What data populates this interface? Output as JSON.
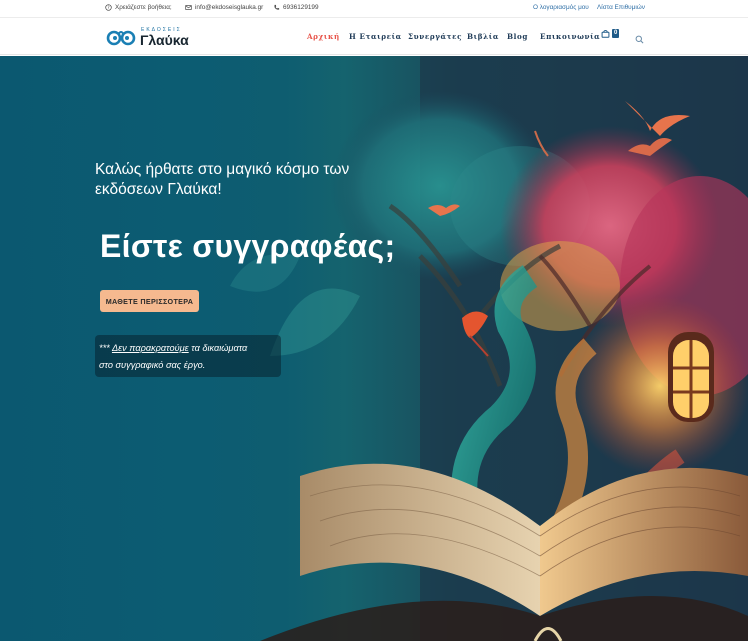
{
  "topbar": {
    "help": {
      "icon": "help-circle-icon",
      "label": "Χρειάζεστε βοήθεια;"
    },
    "email": {
      "icon": "mail-icon",
      "label": "info@ekdoseisglauka.gr"
    },
    "phone": {
      "icon": "phone-icon",
      "label": "6936129199"
    },
    "account_link": "Ο λογαριασμός μου",
    "wishlist_link": "Λίστα Επιθυμιών"
  },
  "header": {
    "logo": {
      "small_text": "ΕΚΔΟΣΕΙΣ",
      "name": "Γλαύκα",
      "icon": "owl-glasses-icon"
    },
    "nav": [
      {
        "label": "Αρχική",
        "active": true
      },
      {
        "label": "Η Εταιρεία",
        "active": false
      },
      {
        "label": "Συνεργάτες",
        "active": false
      },
      {
        "label": "Βιβλία",
        "active": false
      },
      {
        "label": "Blog",
        "active": false
      },
      {
        "label": "Επικοινωνία",
        "active": false
      }
    ],
    "cart": {
      "icon": "shopping-bag-icon",
      "count": "0"
    },
    "search_icon": "search-icon"
  },
  "hero": {
    "welcome": "Καλώς ήρθατε στο μαγικό κόσμο των εκδόσεων Γλαύκα!",
    "headline": "Είστε συγγραφέας;",
    "cta": "ΜΑΘΕΤΕ ΠΕΡΙΣΣΟΤΕΡΑ",
    "notice": {
      "prefix": "***",
      "link": "Δεν παρακρατούμε",
      "rest": "τα δικαιώματα",
      "line2": "στο συγγραφικό σας έργο."
    }
  },
  "colors": {
    "accent_active_nav": "#e8544a",
    "nav_text": "#1f3b57",
    "link_blue": "#2f6fa6",
    "cta_bg": "#f5b98f",
    "hero_bg": "#0b5870"
  }
}
